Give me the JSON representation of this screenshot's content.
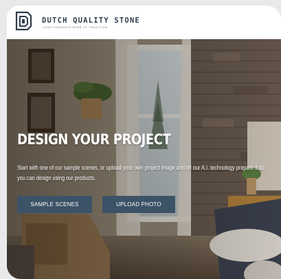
{
  "brand": {
    "name": "DUTCH QUALITY STONE",
    "tagline": "CRAFTSMANSHIP BORN OF TRADITION",
    "color": "#2f3d4b"
  },
  "hero": {
    "title": "DESIGN YOUR PROJECT",
    "description": "Start with one of our sample scenes, or upload your own project image and let our A.I. technology prepare it so you can design using our products.",
    "buttons": {
      "sample_scenes": "SAMPLE SCENES",
      "upload_photo": "UPLOAD PHOTO"
    },
    "button_color": "#3c5266"
  }
}
